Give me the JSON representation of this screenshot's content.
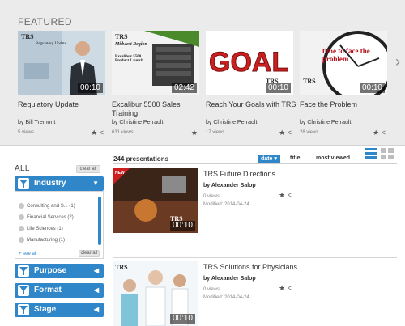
{
  "featured": {
    "heading": "FEATURED",
    "cards": [
      {
        "title": "Regulatory Update",
        "author": "by Bill Tremont",
        "views": "5 views",
        "duration": "00:10",
        "brand": "TRS",
        "thumb_caption": "Regulatory Update"
      },
      {
        "title": "Excalibur 5500 Sales Training",
        "author": "by Christine Perrault",
        "views": "631 views",
        "duration": "02:42",
        "brand": "TRS",
        "thumb_caption": "Midwest Region",
        "thumb_caption2": "Excalibur 5500 Product Launch"
      },
      {
        "title": "Reach Your Goals with TRS",
        "author": "by Christine Perrault",
        "views": "17 views",
        "duration": "00:10",
        "brand": "TRS",
        "thumb_caption": "GOAL"
      },
      {
        "title": "Face the Problem",
        "author": "by Christine Perrault",
        "views": "28 views",
        "duration": "00:10",
        "brand": "TRS",
        "thumb_caption": "time to face the problem"
      }
    ]
  },
  "sidebar": {
    "all_label": "ALL",
    "clear_all": "clear all",
    "facets": [
      {
        "label": "Industry",
        "expanded": true
      },
      {
        "label": "Purpose",
        "expanded": false
      },
      {
        "label": "Format",
        "expanded": false
      },
      {
        "label": "Stage",
        "expanded": false
      }
    ],
    "industry_items": [
      "Consulting and S... (1)",
      "Financial Services (2)",
      "Life Sciences (1)",
      "Manufacturing (1)"
    ],
    "see_all": "+ see all",
    "clear_all_inner": "clear all"
  },
  "results": {
    "count": "244 presentations",
    "sort_options": {
      "date": "date ▾",
      "title": "title",
      "views": "most viewed"
    },
    "items": [
      {
        "title": "TRS Future Directions",
        "author": "by Alexander Salop",
        "views": "0 views",
        "modified": "Modified: 2014-04-24",
        "duration": "00:10",
        "badge": "NEW",
        "brand": "TRS"
      },
      {
        "title": "TRS Solutions for Physicians",
        "author": "by Alexander Salop",
        "views": "0 views",
        "modified": "Modified: 2014-04-24",
        "duration": "00:10",
        "brand": "TRS"
      }
    ]
  },
  "colors": {
    "accent": "#2f86c9",
    "featured_bg": "#ebebeb"
  }
}
